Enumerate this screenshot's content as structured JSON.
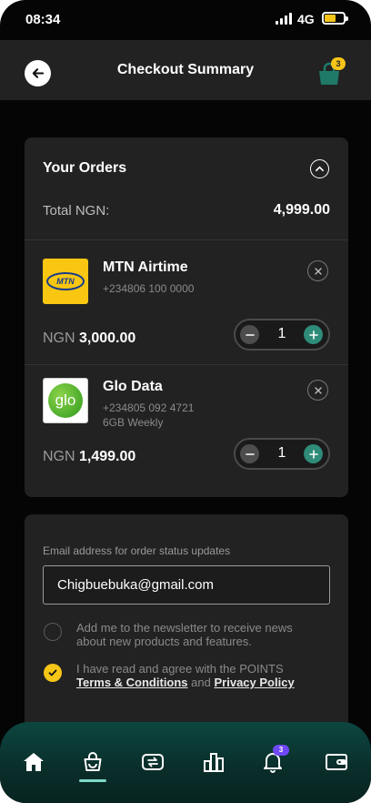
{
  "status": {
    "time": "08:34",
    "network": "4G"
  },
  "header": {
    "title": "Checkout Summary",
    "cart_count": "3"
  },
  "orders": {
    "title": "Your Orders",
    "total_label": "Total NGN:",
    "total_value": "4,999.00",
    "items": [
      {
        "name": "MTN Airtime",
        "sub1": "+234806 100 0000",
        "sub2": "",
        "currency": "NGN",
        "price": "3,000.00",
        "qty": "1",
        "logo_text": "MTN"
      },
      {
        "name": "Glo Data",
        "sub1": "+234805 092 4721",
        "sub2": "6GB Weekly",
        "currency": "NGN",
        "price": "1,499.00",
        "qty": "1",
        "logo_text": "glo"
      }
    ]
  },
  "email_form": {
    "label": "Email address for order status updates",
    "value": "Chigbuebuka@gmail.com",
    "newsletter_text": "Add me to the newsletter to receive news about new products and features.",
    "newsletter_checked": false,
    "terms_prefix": "I have read and agree with the POINTS",
    "terms_link": "Terms & Conditions",
    "terms_and": "and",
    "privacy_link": "Privacy Policy",
    "terms_checked": true
  },
  "nav": {
    "items": [
      "home-icon",
      "shopping-bag-icon",
      "exchange-icon",
      "chart-icon",
      "bell-icon",
      "wallet-icon"
    ],
    "active": "shopping-bag-icon",
    "notification_count": "3"
  },
  "colors": {
    "accent": "#f5c518",
    "teal": "#2e8c79",
    "card": "#222222",
    "background": "#050505",
    "nav_badge": "#6f48f5"
  }
}
